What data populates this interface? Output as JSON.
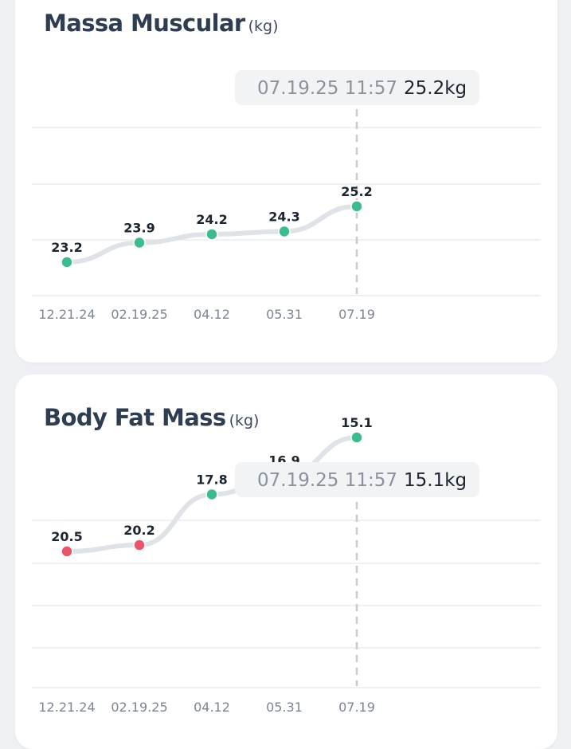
{
  "colors": {
    "line": "#dfe2e7",
    "normal_point": "#3dba8e",
    "high_point": "#e8566c",
    "grid": "#e6e8ec",
    "tooltip_bg": "#f1f3f5"
  },
  "chart_data": [
    {
      "type": "line",
      "title": "Massa Muscular",
      "unit": "(kg)",
      "categories": [
        "12.21.24",
        "02.19.25",
        "04.12",
        "05.31",
        "07.19"
      ],
      "series": [
        {
          "values": [
            23.2,
            23.9,
            24.2,
            24.3,
            25.2
          ],
          "status": [
            "normal",
            "normal",
            "normal",
            "normal",
            "normal"
          ]
        }
      ],
      "selected_index": 4,
      "tooltip": {
        "date": "07.19.25 11:57",
        "value": "25.2kg"
      },
      "grid": true
    },
    {
      "type": "line",
      "title": "Body Fat Mass",
      "unit": "(kg)",
      "categories": [
        "12.21.24",
        "02.19.25",
        "04.12",
        "05.31",
        "07.19"
      ],
      "series": [
        {
          "values": [
            20.5,
            20.2,
            17.8,
            16.9,
            15.1
          ],
          "status": [
            "high",
            "high",
            "normal",
            "normal",
            "normal"
          ]
        }
      ],
      "selected_index": 4,
      "tooltip": {
        "date": "07.19.25 11:57",
        "value": "15.1kg"
      },
      "grid": true
    }
  ]
}
